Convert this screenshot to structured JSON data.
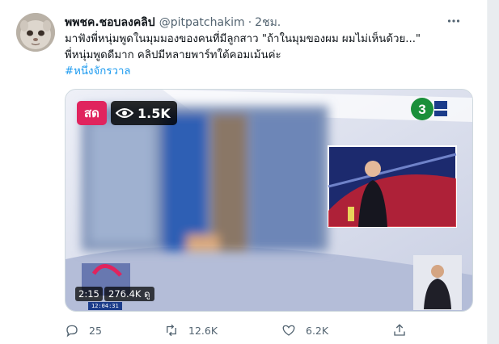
{
  "tweet": {
    "display_name": "พพชค.ชอบลงคลิป",
    "handle": "@pitpatchakim",
    "separator": "·",
    "time": "2ชม.",
    "text_lines": [
      "มาฟังพี่หนุ่มพูดในมุมมองของคนที่มีลูกสาว \"ถ้าในมุมของผม ผมไม่เห็นด้วย...\"",
      "พี่หนุ่มพูดดีมาก คลิปมีหลายพาร์ทใต้คอมเม้นค่ะ"
    ],
    "hashtag": "#หนึ่งจักรวาล"
  },
  "media": {
    "live_label": "สด",
    "view_count": "1.5K",
    "duration": "2:15",
    "video_views": "276.4K ดู",
    "broadcast_time": "12:04:31"
  },
  "actions": {
    "reply_count": "25",
    "retweet_count": "12.6K",
    "like_count": "6.2K"
  },
  "icons": {
    "reply": "reply-icon",
    "retweet": "retweet-icon",
    "like": "heart-icon",
    "share": "share-icon",
    "more": "more-icon",
    "views": "eye-icon"
  },
  "colors": {
    "accent": "#1d9bf0",
    "live": "#e0245e",
    "secondary_text": "#536471"
  }
}
